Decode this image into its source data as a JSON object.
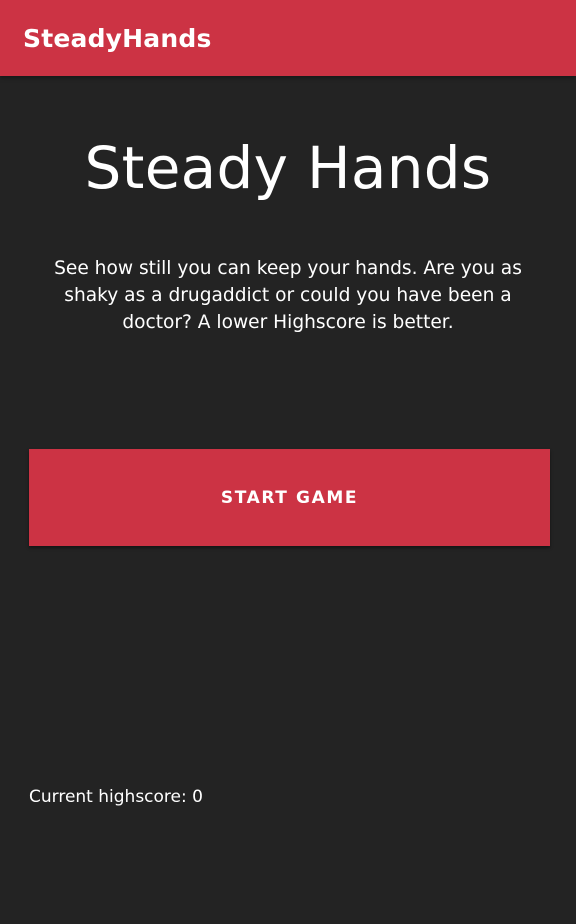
{
  "app_bar": {
    "title": "SteadyHands",
    "color": "#cc3344"
  },
  "main": {
    "title": "Steady Hands",
    "description": "See how still you can keep your hands. Are you as shaky as a drugaddict or could you have been a doctor? A lower Highscore is better.",
    "start_button_label": "START GAME",
    "highscore_text": "Current highscore: 0"
  },
  "colors": {
    "background": "#232323",
    "accent": "#cc3344",
    "text": "#ffffff"
  }
}
